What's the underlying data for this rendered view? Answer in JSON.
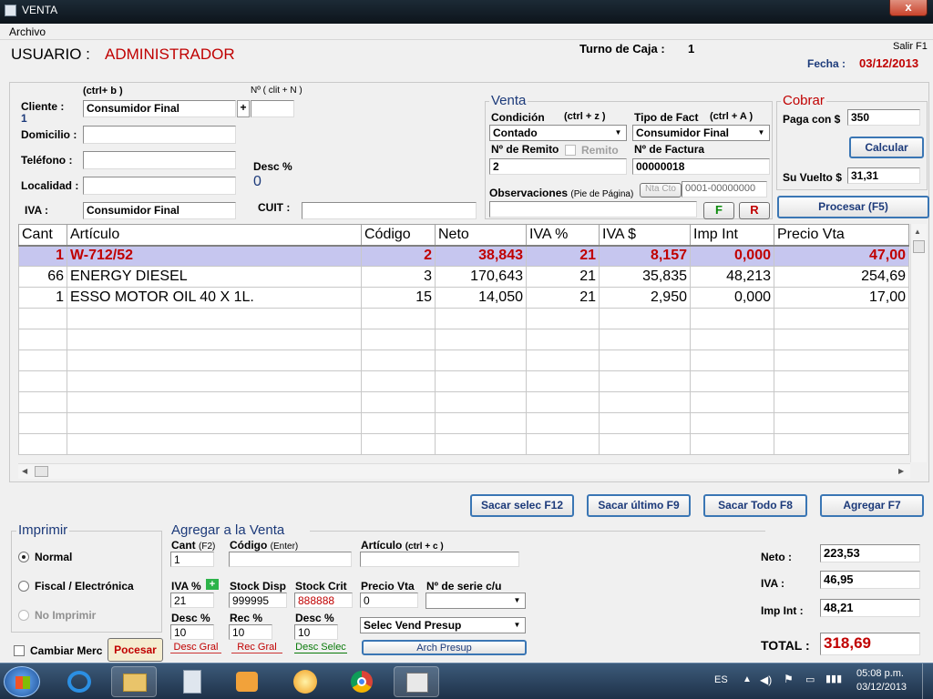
{
  "window": {
    "title": "VENTA",
    "close": "x"
  },
  "menu": {
    "archivo": "Archivo"
  },
  "header": {
    "usuario_label": "USUARIO :",
    "usuario": "ADMINISTRADOR",
    "turno_label": "Turno de Caja :",
    "turno": "1",
    "salir": "Salir F1",
    "fecha_label": "Fecha :",
    "fecha": "03/12/2013"
  },
  "cliente": {
    "label": "Cliente :",
    "shortcut": "(ctrl+ b )",
    "num_shortcut": "Nº ( clit + N )",
    "id": "1",
    "value": "Consumidor Final",
    "plus": "+",
    "num_value": "",
    "domicilio_label": "Domicilio :",
    "domicilio": "",
    "telefono_label": "Teléfono :",
    "telefono": "",
    "localidad_label": "Localidad :",
    "localidad": "",
    "iva_label": "IVA :",
    "iva": "Consumidor Final",
    "cuit_label": "CUIT :",
    "cuit": "",
    "desc_label": "Desc %",
    "desc": "0"
  },
  "venta": {
    "title": "Venta",
    "condicion_label": "Condición",
    "condicion_shortcut": "(ctrl + z )",
    "condicion": "Contado",
    "tipo_label": "Tipo de Fact",
    "tipo_shortcut": "(ctrl + A )",
    "tipo": "Consumidor Final",
    "remito_label": "Nº de Remito",
    "remito_chk": "Remito",
    "remito": "2",
    "factura_label": "Nº de Factura",
    "factura": "00000018",
    "obs_label": "Observaciones",
    "obs_sub": "(Pie de Página)",
    "nta_cto": "Nta Cto",
    "nta_num": "0001-00000000",
    "obs": "",
    "f_btn": "F",
    "r_btn": "R"
  },
  "cobrar": {
    "title": "Cobrar",
    "paga_label": "Paga con $",
    "paga": "350",
    "calcular": "Calcular",
    "vuelto_label": "Su Vuelto $",
    "vuelto": "31,31",
    "procesar": "Procesar (F5)"
  },
  "grid": {
    "headers": [
      "Cant",
      "Artículo",
      "Código",
      "Neto",
      "IVA %",
      "IVA $",
      "Imp Int",
      "Precio Vta"
    ],
    "rows": [
      [
        "1",
        "W-712/52",
        "2",
        "38,843",
        "21",
        "8,157",
        "0,000",
        "47,00"
      ],
      [
        "66",
        "ENERGY DIESEL",
        "3",
        "170,643",
        "21",
        "35,835",
        "48,213",
        "254,69"
      ],
      [
        "1",
        "ESSO MOTOR OIL 40 X 1L.",
        "15",
        "14,050",
        "21",
        "2,950",
        "0,000",
        "17,00"
      ]
    ],
    "empty_rows": 7
  },
  "actions": {
    "sacar_selec": "Sacar selec F12",
    "sacar_ultimo": "Sacar último F9",
    "sacar_todo": "Sacar Todo   F8",
    "agregar": "Agregar    F7"
  },
  "imprimir": {
    "title": "Imprimir",
    "normal": "Normal",
    "fiscal": "Fiscal / Electrónica",
    "no_imprimir": "No Imprimir",
    "cambiar_merc": "Cambiar Merc",
    "procesar": "Pocesar"
  },
  "agregar": {
    "title": "Agregar a la Venta",
    "cant_label": "Cant",
    "cant_short": "(F2)",
    "cant": "1",
    "codigo_label": "Código",
    "codigo_short": "(Enter)",
    "codigo": "",
    "articulo_label": "Artículo",
    "articulo_short": "(ctrl + c )",
    "articulo": "",
    "iva_label": "IVA %",
    "iva": "21",
    "stock_disp_label": "Stock Disp",
    "stock_disp": "999995",
    "stock_crit_label": "Stock Crit",
    "stock_crit": "888888",
    "precio_label": "Precio Vta",
    "precio": "0",
    "serie_label": "Nº de serie c/u",
    "serie": "",
    "desc_label": "Desc %",
    "desc": "10",
    "rec_label": "Rec %",
    "rec": "10",
    "desc2_label": "Desc %",
    "desc2": "10",
    "vend": "Selec Vend Presup",
    "desc_gral": "Desc Gral",
    "rec_gral": "Rec Gral",
    "desc_selec": "Desc Selec",
    "arch_presup": "Arch Presup"
  },
  "totales": {
    "neto_label": "Neto :",
    "neto": "223,53",
    "iva_label": "IVA :",
    "iva": "46,95",
    "impint_label": "Imp Int :",
    "impint": "48,21",
    "total_label": "TOTAL :",
    "total": "318,69"
  },
  "taskbar": {
    "lang": "ES",
    "time": "05:08 p.m.",
    "date": "03/12/2013"
  }
}
